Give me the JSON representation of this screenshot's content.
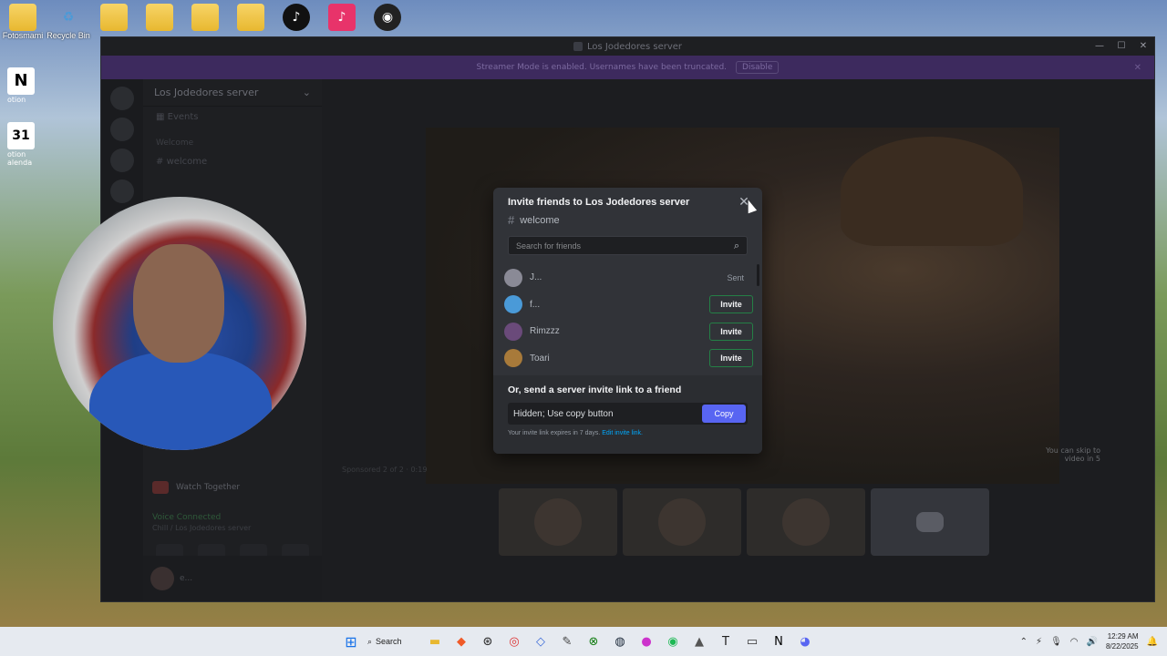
{
  "desktop": {
    "icons": [
      {
        "label": "Fotosmami",
        "icon": "folder-icon"
      },
      {
        "label": "Recycle Bin",
        "icon": "recycle-bin-icon"
      },
      {
        "label": "",
        "icon": "folder-icon"
      },
      {
        "label": "",
        "icon": "folder-icon"
      },
      {
        "label": "",
        "icon": "folder-icon"
      },
      {
        "label": "",
        "icon": "folder-icon"
      },
      {
        "label": "",
        "icon": "tiktok-icon"
      },
      {
        "label": "",
        "icon": "tiktok-icon"
      },
      {
        "label": "",
        "icon": "obs-icon"
      }
    ],
    "left_icons": [
      {
        "label": "otion",
        "glyph": "N"
      },
      {
        "label": "otion alenda",
        "glyph": "31"
      }
    ]
  },
  "window": {
    "title": "Los Jodedores server",
    "controls": [
      "—",
      "☐",
      "✕"
    ],
    "banner": {
      "message": "Streamer Mode is enabled. Usernames have been truncated.",
      "button": "Disable"
    }
  },
  "sidebar": {
    "server_name": "Los Jodedores server",
    "events": "Events",
    "category": "Welcome",
    "channel": "welcome",
    "watch_together": "Watch Together",
    "voice_connected": "Voice Connected",
    "voice_channel": "Chill / Los Jodedores server",
    "user_name": "e..."
  },
  "video": {
    "sponsored": "Sponsored 2 of 2 · 0:19",
    "skip": "You can skip to video in 5"
  },
  "modal": {
    "title": "Invite friends to Los Jodedores server",
    "channel": "welcome",
    "search_placeholder": "Search for friends",
    "friends": [
      {
        "name": "J...",
        "status": "Sent",
        "action": "",
        "color": "#8a8a96"
      },
      {
        "name": "f...",
        "status": "",
        "action": "Invite",
        "color": "#4a9ad8"
      },
      {
        "name": "Rimzzz",
        "status": "",
        "action": "Invite",
        "color": "#6a4a7a"
      },
      {
        "name": "Toari",
        "status": "",
        "action": "Invite",
        "color": "#a87a3a"
      }
    ],
    "link_label": "Or, send a server invite link to a friend",
    "link_value": "Hidden; Use copy button",
    "copy_label": "Copy",
    "expire_text": "Your invite link expires in 7 days.",
    "edit_link": "Edit invite link."
  },
  "taskbar": {
    "search": "Search",
    "time": "12:29 AM",
    "date": "8/22/2025"
  }
}
